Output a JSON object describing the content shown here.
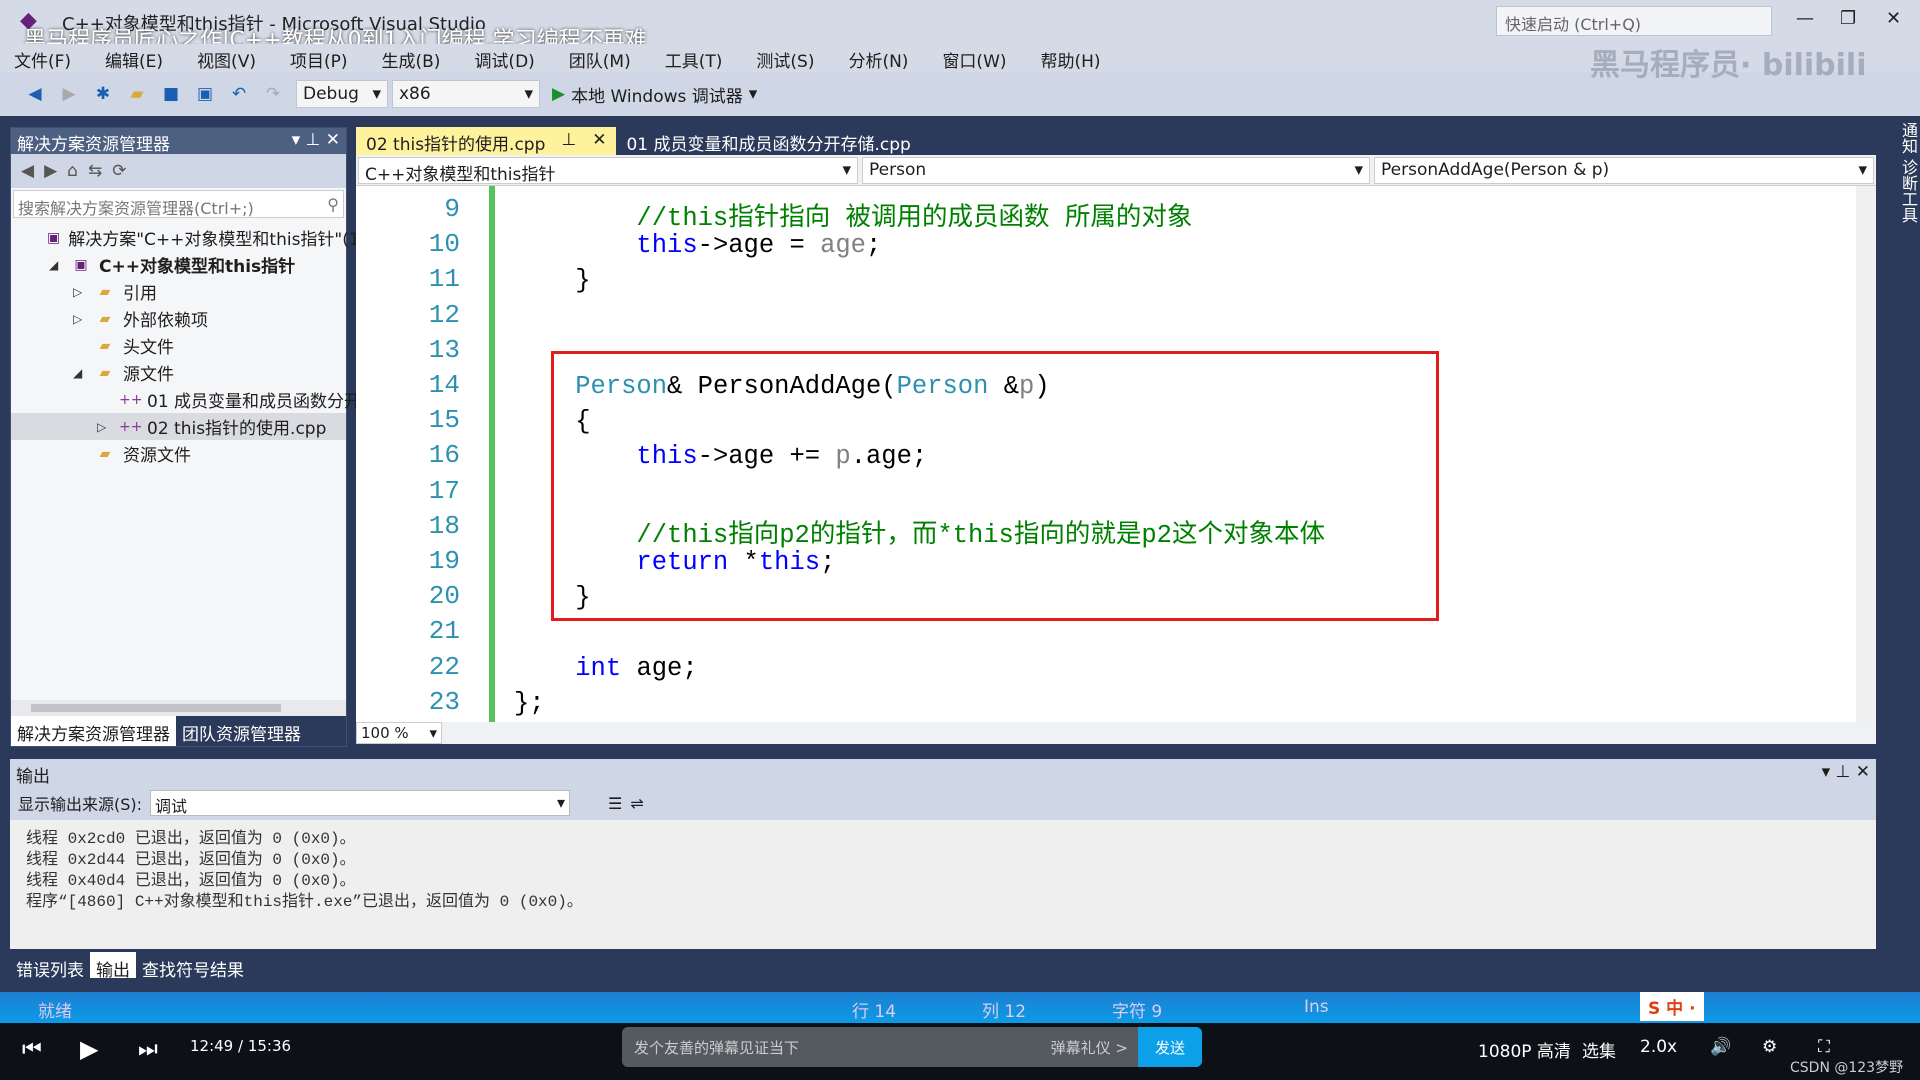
{
  "window": {
    "title": "C++对象模型和this指针 - Microsoft Visual Studio",
    "video_overlay": "黑马程序员匠心之作|C++教程从0到1入门编程,学习编程不再难",
    "quick_launch": "快速启动 (Ctrl+Q)",
    "logo": "黑马程序员· bilibili"
  },
  "menu": [
    "文件(F)",
    "编辑(E)",
    "视图(V)",
    "项目(P)",
    "生成(B)",
    "调试(D)",
    "团队(M)",
    "工具(T)",
    "测试(S)",
    "分析(N)",
    "窗口(W)",
    "帮助(H)"
  ],
  "toolbar": {
    "config": "Debug",
    "platform": "x86",
    "run": "本地 Windows 调试器"
  },
  "solution_explorer": {
    "title": "解决方案资源管理器",
    "search_placeholder": "搜索解决方案资源管理器(Ctrl+;)",
    "items": [
      {
        "label": "解决方案\"C++对象模型和this指针\"(1 个项目)",
        "depth": 0,
        "exp": ""
      },
      {
        "label": "C++对象模型和this指针",
        "depth": 1,
        "exp": "◢",
        "bold": true
      },
      {
        "label": "引用",
        "depth": 2,
        "exp": "▷"
      },
      {
        "label": "外部依赖项",
        "depth": 2,
        "exp": "▷"
      },
      {
        "label": "头文件",
        "depth": 2,
        "exp": ""
      },
      {
        "label": "源文件",
        "depth": 2,
        "exp": "◢"
      },
      {
        "label": "01 成员变量和成员函数分开存储.cpp",
        "depth": 3,
        "exp": ""
      },
      {
        "label": "02 this指针的使用.cpp",
        "depth": 3,
        "exp": "▷",
        "selected": true
      },
      {
        "label": "资源文件",
        "depth": 2,
        "exp": ""
      }
    ],
    "tabs": [
      "解决方案资源管理器",
      "团队资源管理器"
    ]
  },
  "editor": {
    "tabs": [
      "02 this指针的使用.cpp",
      "01 成员变量和成员函数分开存储.cpp"
    ],
    "nav": [
      "C++对象模型和this指针",
      "Person",
      "PersonAddAge(Person & p)"
    ],
    "zoom": "100 %",
    "lines": [
      {
        "n": "9",
        "t": [
          [
            "        ",
            ""
          ],
          [
            "//this指针指向 被调用的成员函数 所属的对象",
            "cm"
          ]
        ]
      },
      {
        "n": "10",
        "t": [
          [
            "        ",
            ""
          ],
          [
            "this",
            "kw"
          ],
          [
            "->age = ",
            ""
          ],
          [
            "age",
            "pa"
          ],
          [
            ";",
            ""
          ]
        ]
      },
      {
        "n": "11",
        "t": [
          [
            "    }",
            ""
          ]
        ]
      },
      {
        "n": "12",
        "t": []
      },
      {
        "n": "13",
        "t": []
      },
      {
        "n": "14",
        "t": [
          [
            "    ",
            ""
          ],
          [
            "Person",
            "ty"
          ],
          [
            "& PersonAddAge(",
            ""
          ],
          [
            "Person",
            "ty"
          ],
          [
            " &",
            ""
          ],
          [
            "p",
            "pa"
          ],
          [
            ")",
            ""
          ]
        ]
      },
      {
        "n": "15",
        "t": [
          [
            "    {",
            ""
          ]
        ]
      },
      {
        "n": "16",
        "t": [
          [
            "        ",
            ""
          ],
          [
            "this",
            "kw"
          ],
          [
            "->age += ",
            ""
          ],
          [
            "p",
            "pa"
          ],
          [
            ".age;",
            ""
          ]
        ]
      },
      {
        "n": "17",
        "t": []
      },
      {
        "n": "18",
        "t": [
          [
            "        ",
            ""
          ],
          [
            "//this指向p2的指针，而*this指向的就是p2这个对象本体",
            "cm"
          ]
        ]
      },
      {
        "n": "19",
        "t": [
          [
            "        ",
            ""
          ],
          [
            "return",
            "kw"
          ],
          [
            " *",
            ""
          ],
          [
            "this",
            "kw"
          ],
          [
            ";",
            ""
          ]
        ]
      },
      {
        "n": "20",
        "t": [
          [
            "    }",
            ""
          ]
        ]
      },
      {
        "n": "21",
        "t": []
      },
      {
        "n": "22",
        "t": [
          [
            "    ",
            ""
          ],
          [
            "int",
            "kw"
          ],
          [
            " age;",
            ""
          ]
        ]
      },
      {
        "n": "23",
        "t": [
          [
            "};",
            ""
          ]
        ]
      }
    ]
  },
  "output": {
    "title": "输出",
    "source_label": "显示输出来源(S):",
    "source": "调试",
    "lines": [
      "线程 0x2cd0 已退出，返回值为 0 (0x0)。",
      "线程 0x2d44 已退出，返回值为 0 (0x0)。",
      "线程 0x40d4 已退出，返回值为 0 (0x0)。",
      "程序“[4860] C++对象模型和this指针.exe”已退出，返回值为 0 (0x0)。"
    ],
    "tabs": [
      "错误列表",
      "输出",
      "查找符号结果"
    ]
  },
  "status": {
    "ready": "就绪",
    "line": "行 14",
    "col": "列 12",
    "char": "字符 9",
    "mode": "Ins"
  },
  "right_strip": "通知  诊断工具",
  "player": {
    "time": "12:49 / 15:36",
    "danmu_placeholder": "发个友善的弹幕见证当下",
    "danmu_etiquette": "弹幕礼仪 >",
    "send": "发送",
    "quality": "1080P 高清",
    "episodes": "选集",
    "speed": "2.0x",
    "watermark": "CSDN @123梦野"
  }
}
